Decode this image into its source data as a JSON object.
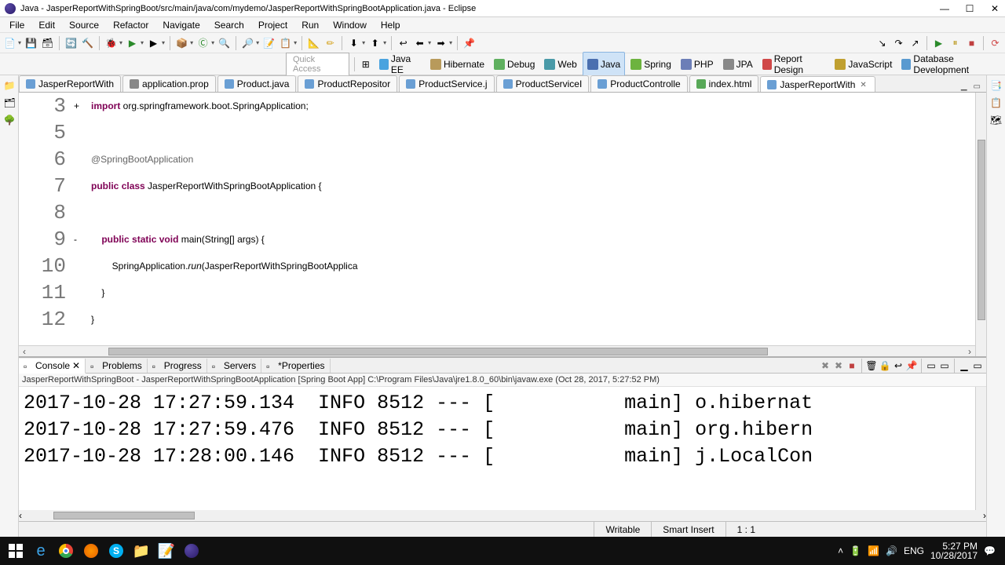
{
  "window": {
    "title": "Java - JasperReportWithSpringBoot/src/main/java/com/mydemo/JasperReportWithSpringBootApplication.java - Eclipse"
  },
  "menubar": [
    "File",
    "Edit",
    "Source",
    "Refactor",
    "Navigate",
    "Search",
    "Project",
    "Run",
    "Window",
    "Help"
  ],
  "quick_access": "Quick Access",
  "perspectives": [
    {
      "label": "Java EE",
      "color": "#4aa3df"
    },
    {
      "label": "Hibernate",
      "color": "#b89a5b"
    },
    {
      "label": "Debug",
      "color": "#5fb05f"
    },
    {
      "label": "Web",
      "color": "#4a9aa8"
    },
    {
      "label": "Java",
      "color": "#4a6fb0",
      "active": true
    },
    {
      "label": "Spring",
      "color": "#6db33f"
    },
    {
      "label": "PHP",
      "color": "#6c7eb7"
    },
    {
      "label": "JPA",
      "color": "#888"
    },
    {
      "label": "Report Design",
      "color": "#d04848"
    },
    {
      "label": "JavaScript",
      "color": "#c0a030"
    },
    {
      "label": "Database Development",
      "color": "#5a9ad0"
    }
  ],
  "editor_tabs": [
    {
      "label": "JasperReportWith",
      "icon": "#6a9fd4"
    },
    {
      "label": "application.prop",
      "icon": "#888"
    },
    {
      "label": "Product.java",
      "icon": "#6a9fd4"
    },
    {
      "label": "ProductRepositor",
      "icon": "#6a9fd4"
    },
    {
      "label": "ProductService.j",
      "icon": "#6a9fd4"
    },
    {
      "label": "ProductServiceI",
      "icon": "#6a9fd4"
    },
    {
      "label": "ProductControlle",
      "icon": "#6a9fd4"
    },
    {
      "label": "index.html",
      "icon": "#58a858"
    },
    {
      "label": "JasperReportWith",
      "icon": "#6a9fd4",
      "active": true
    }
  ],
  "code": {
    "lines": [
      {
        "n": "3",
        "marker": "+",
        "html": "<span class='kw'>import</span> org.springframework.boot.SpringApplication;"
      },
      {
        "n": "5",
        "marker": "",
        "html": ""
      },
      {
        "n": "6",
        "marker": "",
        "html": "<span class='ann'>@SpringBootApplication</span>"
      },
      {
        "n": "7",
        "marker": "",
        "html": "<span class='kw'>public</span> <span class='kw'>class</span> JasperReportWithSpringBootApplication {"
      },
      {
        "n": "8",
        "marker": "",
        "html": ""
      },
      {
        "n": "9",
        "marker": "-",
        "html": "    <span class='kw'>public</span> <span class='kw'>static</span> <span class='kw'>void</span> main(String[] args) {"
      },
      {
        "n": "10",
        "marker": "",
        "html": "        SpringApplication.<span class='method-call'>run</span>(JasperReportWithSpringBootApplica"
      },
      {
        "n": "11",
        "marker": "",
        "html": "    }"
      },
      {
        "n": "12",
        "marker": "",
        "html": "}"
      }
    ]
  },
  "bottom_tabs": [
    {
      "label": "Console",
      "active": true
    },
    {
      "label": "Problems"
    },
    {
      "label": "Progress"
    },
    {
      "label": "Servers"
    },
    {
      "label": "*Properties"
    }
  ],
  "console": {
    "launch": "JasperReportWithSpringBoot - JasperReportWithSpringBootApplication [Spring Boot App] C:\\Program Files\\Java\\jre1.8.0_60\\bin\\javaw.exe (Oct 28, 2017, 5:27:52 PM)",
    "lines": [
      "2017-10-28 17:27:59.134  INFO 8512 --- [           main] o.hibernat",
      "2017-10-28 17:27:59.476  INFO 8512 --- [           main] org.hibern",
      "2017-10-28 17:28:00.146  INFO 8512 --- [           main] j.LocalCon"
    ]
  },
  "statusbar": {
    "writable": "Writable",
    "insert": "Smart Insert",
    "pos": "1 : 1"
  },
  "taskbar": {
    "lang": "ENG",
    "time": "5:27 PM",
    "date": "10/28/2017"
  }
}
